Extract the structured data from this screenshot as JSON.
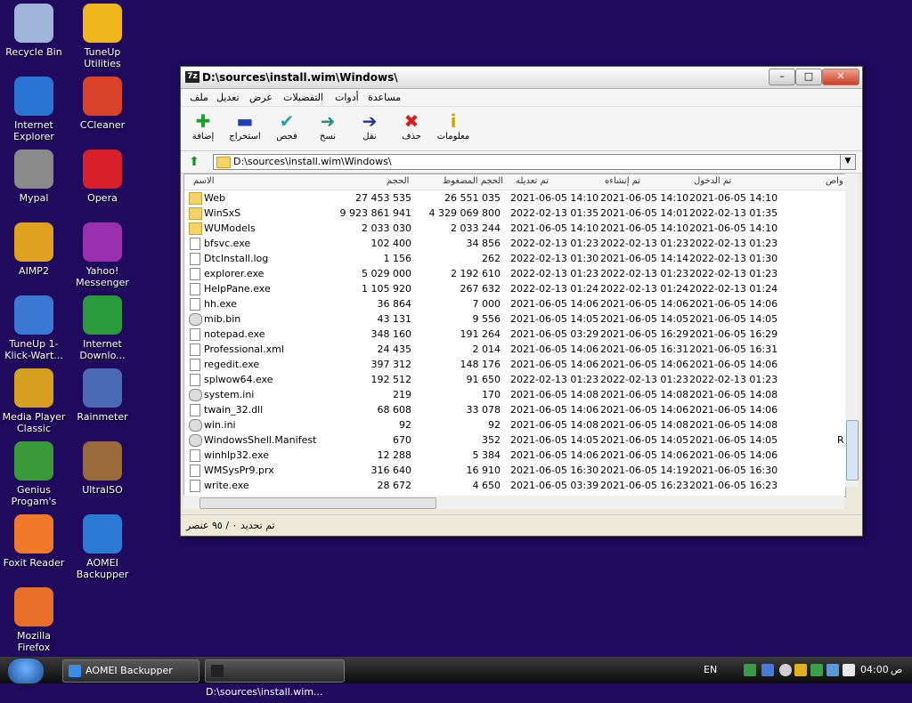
{
  "desktop": {
    "icons": [
      {
        "label": "Recycle Bin"
      },
      {
        "label": "TuneUp Utilities"
      },
      {
        "label": "Internet Explorer"
      },
      {
        "label": "CCleaner"
      },
      {
        "label": "Mypal"
      },
      {
        "label": "Opera"
      },
      {
        "label": "AIMP2"
      },
      {
        "label": "Yahoo! Messenger"
      },
      {
        "label": "TuneUp 1-Klick-Wart..."
      },
      {
        "label": "Internet Downlo..."
      },
      {
        "label": "Media Player Classic"
      },
      {
        "label": "Rainmeter"
      },
      {
        "label": "Genius Progam's"
      },
      {
        "label": "UltraISO"
      },
      {
        "label": "Foxit Reader"
      },
      {
        "label": "AOMEI Backupper"
      },
      {
        "label": "Mozilla Firefox"
      }
    ]
  },
  "window": {
    "title": "D:\\sources\\install.wim\\Windows\\",
    "app_icon": "7z",
    "menu": [
      "ملف",
      "تعديل",
      "عرض",
      "التفضيلات",
      "أدوات",
      "مساعدة"
    ],
    "toolbar": [
      {
        "label": "إضافة",
        "icon": "plus-icon",
        "color": "#1e9e2a"
      },
      {
        "label": "استخراج",
        "icon": "minus-icon",
        "color": "#1f3fb8"
      },
      {
        "label": "فحص",
        "icon": "check-icon",
        "color": "#2aa0a8"
      },
      {
        "label": "نسخ",
        "icon": "copy-arrow-icon",
        "color": "#2a8f7a"
      },
      {
        "label": "نقل",
        "icon": "move-arrow-icon",
        "color": "#1f2f9e"
      },
      {
        "label": "حذف",
        "icon": "delete-x-icon",
        "color": "#d11e1e"
      },
      {
        "label": "معلومات",
        "icon": "info-icon",
        "color": "#c9a800"
      }
    ],
    "address": "D:\\sources\\install.wim\\Windows\\",
    "columns": [
      "الاسم",
      "الحجم",
      "الحجم المضغوط",
      "تم تعديله",
      "تم إنشاءه",
      "تم الدخول",
      "واص"
    ],
    "rows": [
      {
        "name": "Web",
        "type": "folder",
        "size": "27 453 535",
        "packed": "26 551 035",
        "modified": "2021-06-05 14:10",
        "created": "2021-06-05 14:10",
        "accessed": "2021-06-05 14:10"
      },
      {
        "name": "WinSxS",
        "type": "folder",
        "size": "9 923 861 941",
        "packed": "4 329 069 800",
        "modified": "2022-02-13 01:35",
        "created": "2021-06-05 14:01",
        "accessed": "2022-02-13 01:35"
      },
      {
        "name": "WUModels",
        "type": "folder",
        "size": "2 033 030",
        "packed": "2 033 244",
        "modified": "2021-06-05 14:10",
        "created": "2021-06-05 14:10",
        "accessed": "2021-06-05 14:10"
      },
      {
        "name": "bfsvc.exe",
        "type": "file",
        "size": "102 400",
        "packed": "34 856",
        "modified": "2022-02-13 01:23",
        "created": "2022-02-13 01:23",
        "accessed": "2022-02-13 01:23"
      },
      {
        "name": "DtcInstall.log",
        "type": "file",
        "size": "1 156",
        "packed": "262",
        "modified": "2022-02-13 01:30",
        "created": "2021-06-05 14:14",
        "accessed": "2022-02-13 01:30"
      },
      {
        "name": "explorer.exe",
        "type": "file",
        "size": "5 029 000",
        "packed": "2 192 610",
        "modified": "2022-02-13 01:23",
        "created": "2022-02-13 01:23",
        "accessed": "2022-02-13 01:23"
      },
      {
        "name": "HelpPane.exe",
        "type": "file",
        "size": "1 105 920",
        "packed": "267 632",
        "modified": "2022-02-13 01:24",
        "created": "2022-02-13 01:24",
        "accessed": "2022-02-13 01:24"
      },
      {
        "name": "hh.exe",
        "type": "file",
        "size": "36 864",
        "packed": "7 000",
        "modified": "2021-06-05 14:06",
        "created": "2021-06-05 14:06",
        "accessed": "2021-06-05 14:06"
      },
      {
        "name": "mib.bin",
        "type": "gear",
        "size": "43 131",
        "packed": "9 556",
        "modified": "2021-06-05 14:05",
        "created": "2021-06-05 14:05",
        "accessed": "2021-06-05 14:05"
      },
      {
        "name": "notepad.exe",
        "type": "file",
        "size": "348 160",
        "packed": "191 264",
        "modified": "2021-06-05 03:29",
        "created": "2021-06-05 16:29",
        "accessed": "2021-06-05 16:29"
      },
      {
        "name": "Professional.xml",
        "type": "file",
        "size": "24 435",
        "packed": "2 014",
        "modified": "2021-06-05 14:06",
        "created": "2021-06-05 16:31",
        "accessed": "2021-06-05 16:31"
      },
      {
        "name": "regedit.exe",
        "type": "file",
        "size": "397 312",
        "packed": "148 176",
        "modified": "2021-06-05 14:06",
        "created": "2021-06-05 14:06",
        "accessed": "2021-06-05 14:06"
      },
      {
        "name": "splwow64.exe",
        "type": "file",
        "size": "192 512",
        "packed": "91 650",
        "modified": "2022-02-13 01:23",
        "created": "2022-02-13 01:23",
        "accessed": "2022-02-13 01:23"
      },
      {
        "name": "system.ini",
        "type": "gear",
        "size": "219",
        "packed": "170",
        "modified": "2021-06-05 14:08",
        "created": "2021-06-05 14:08",
        "accessed": "2021-06-05 14:08"
      },
      {
        "name": "twain_32.dll",
        "type": "file",
        "size": "68 608",
        "packed": "33 078",
        "modified": "2021-06-05 14:06",
        "created": "2021-06-05 14:06",
        "accessed": "2021-06-05 14:06"
      },
      {
        "name": "win.ini",
        "type": "gear",
        "size": "92",
        "packed": "92",
        "modified": "2021-06-05 14:08",
        "created": "2021-06-05 14:08",
        "accessed": "2021-06-05 14:08"
      },
      {
        "name": "WindowsShell.Manifest",
        "type": "gear",
        "size": "670",
        "packed": "352",
        "modified": "2021-06-05 14:05",
        "created": "2021-06-05 14:05",
        "accessed": "2021-06-05 14:05",
        "extra": "R"
      },
      {
        "name": "winhlp32.exe",
        "type": "file",
        "size": "12 288",
        "packed": "5 384",
        "modified": "2021-06-05 14:06",
        "created": "2021-06-05 14:06",
        "accessed": "2021-06-05 14:06"
      },
      {
        "name": "WMSysPr9.prx",
        "type": "file",
        "size": "316 640",
        "packed": "16 910",
        "modified": "2021-06-05 16:30",
        "created": "2021-06-05 14:19",
        "accessed": "2021-06-05 16:30"
      },
      {
        "name": "write.exe",
        "type": "file",
        "size": "28 672",
        "packed": "4 650",
        "modified": "2021-06-05 03:39",
        "created": "2021-06-05 16:23",
        "accessed": "2021-06-05 16:23"
      }
    ],
    "status": "تم تحديد ٠ / ٩٥ عنصر"
  },
  "taskbar": {
    "tasks": [
      {
        "label": "AOMEI Backupper"
      },
      {
        "label": "D:\\sources\\install.wim..."
      }
    ],
    "lang": "EN",
    "time": "04:00",
    "ampm": "ص"
  }
}
